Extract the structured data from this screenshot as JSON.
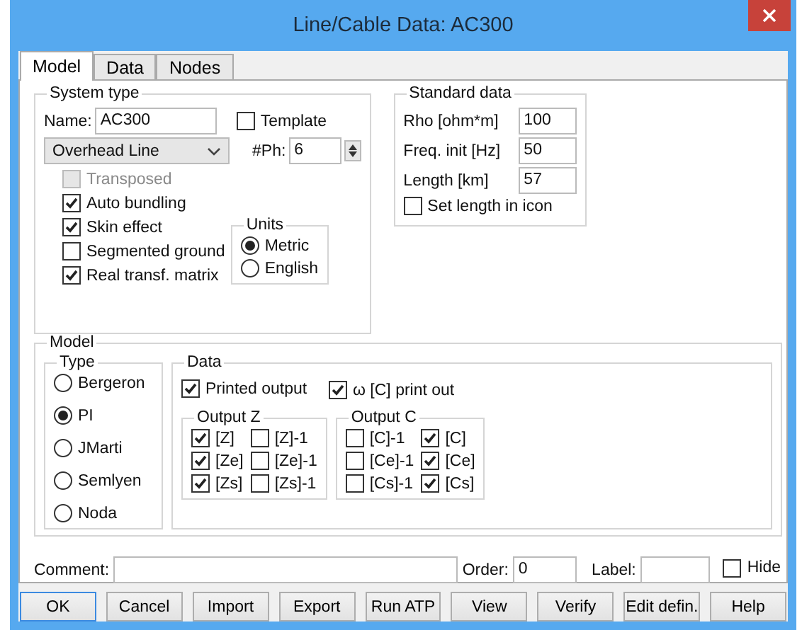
{
  "window": {
    "title": "Line/Cable Data: AC300"
  },
  "tabs": [
    {
      "label": "Model",
      "selected": true
    },
    {
      "label": "Data",
      "selected": false
    },
    {
      "label": "Nodes",
      "selected": false
    }
  ],
  "system_type": {
    "title": "System type",
    "name_label": "Name:",
    "name_value": "AC300",
    "template": {
      "label": "Template",
      "checked": false
    },
    "line_type": "Overhead Line",
    "phases_label": "#Ph:",
    "phases_value": "6",
    "options": [
      {
        "label": "Transposed",
        "checked": false,
        "disabled": true
      },
      {
        "label": "Auto bundling",
        "checked": true,
        "disabled": false
      },
      {
        "label": "Skin effect",
        "checked": true,
        "disabled": false
      },
      {
        "label": "Segmented ground",
        "checked": false,
        "disabled": false
      },
      {
        "label": "Real transf. matrix",
        "checked": true,
        "disabled": false
      }
    ],
    "units": {
      "title": "Units",
      "options": [
        {
          "label": "Metric",
          "selected": true
        },
        {
          "label": "English",
          "selected": false
        }
      ]
    }
  },
  "standard_data": {
    "title": "Standard data",
    "fields": [
      {
        "label": "Rho [ohm*m]",
        "value": "100"
      },
      {
        "label": "Freq. init [Hz]",
        "value": "50"
      },
      {
        "label": "Length [km]",
        "value": "57"
      }
    ],
    "set_length": {
      "label": "Set length in icon",
      "checked": false
    }
  },
  "model": {
    "title": "Model",
    "type": {
      "title": "Type",
      "options": [
        {
          "label": "Bergeron",
          "selected": false
        },
        {
          "label": "PI",
          "selected": true
        },
        {
          "label": "JMarti",
          "selected": false
        },
        {
          "label": "Semlyen",
          "selected": false
        },
        {
          "label": "Noda",
          "selected": false
        }
      ]
    },
    "data": {
      "title": "Data",
      "printed_output": {
        "label": "Printed output",
        "checked": true
      },
      "c_print": {
        "label": "ω [C] print out",
        "checked": true
      },
      "output_z": {
        "title": "Output Z",
        "items": [
          {
            "label": "[Z]",
            "checked": true
          },
          {
            "label": "[Z]-1",
            "checked": false
          },
          {
            "label": "[Ze]",
            "checked": true
          },
          {
            "label": "[Ze]-1",
            "checked": false
          },
          {
            "label": "[Zs]",
            "checked": true
          },
          {
            "label": "[Zs]-1",
            "checked": false
          }
        ]
      },
      "output_c": {
        "title": "Output C",
        "items": [
          {
            "label": "[C]-1",
            "checked": false
          },
          {
            "label": "[C]",
            "checked": true
          },
          {
            "label": "[Ce]-1",
            "checked": false
          },
          {
            "label": "[Ce]",
            "checked": true
          },
          {
            "label": "[Cs]-1",
            "checked": false
          },
          {
            "label": "[Cs]",
            "checked": true
          }
        ]
      }
    }
  },
  "footer": {
    "comment_label": "Comment:",
    "order_label": "Order:",
    "order_value": "0",
    "label_label": "Label:",
    "hide": {
      "label": "Hide",
      "checked": false
    }
  },
  "buttons": [
    {
      "label": "OK",
      "focused": true
    },
    {
      "label": "Cancel",
      "focused": false
    },
    {
      "label": "Import",
      "focused": false
    },
    {
      "label": "Export",
      "focused": false
    },
    {
      "label": "Run ATP",
      "focused": false
    },
    {
      "label": "View",
      "focused": false
    },
    {
      "label": "Verify",
      "focused": false
    },
    {
      "label": "Edit defin.",
      "focused": false
    },
    {
      "label": "Help",
      "focused": false
    }
  ]
}
